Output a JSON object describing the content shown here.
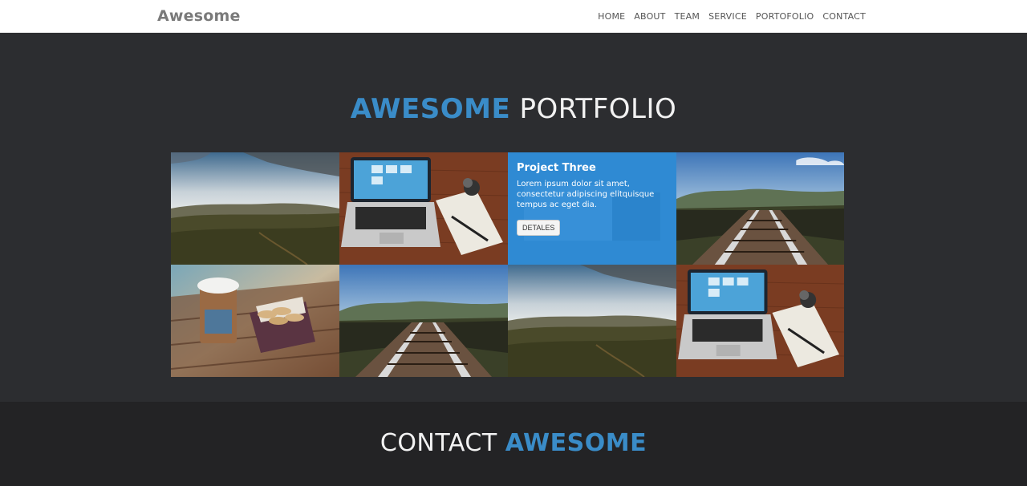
{
  "navbar": {
    "brand": "Awesome",
    "items": [
      "HOME",
      "ABOUT",
      "TEAM",
      "SERVICE",
      "PORTOFOLIO",
      "CONTACT"
    ]
  },
  "portfolio": {
    "title_accent": "AWESOME",
    "title_rest": "PORTFOLIO",
    "tiles": [
      {
        "image": "landscape-hills-photo"
      },
      {
        "image": "laptop-desk-photo"
      },
      {
        "image": "project-overlay",
        "title": "Project Three",
        "text": "Lorem ipsum dolor sit amet, consectetur adipiscing elitquisque tempus ac eget dia.",
        "button": "DETALES"
      },
      {
        "image": "railway-bridge-photo"
      },
      {
        "image": "coffee-cookies-photo"
      },
      {
        "image": "railway-bridge-photo"
      },
      {
        "image": "landscape-hills-photo"
      },
      {
        "image": "laptop-desk-photo"
      }
    ],
    "overlay_color": "#2b8fdc"
  },
  "contact": {
    "title_rest": "CONTACT",
    "title_accent": "AWESOME"
  },
  "colors": {
    "accent": "#3a8cc8",
    "dark_bg": "#2c2d30",
    "darker_bg": "#232325"
  }
}
